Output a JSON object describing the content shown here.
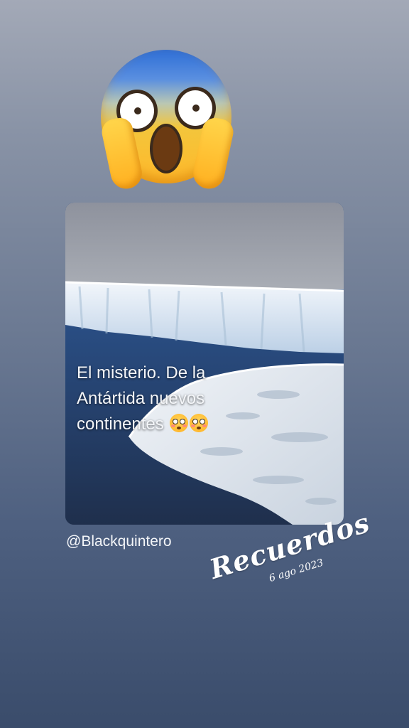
{
  "story": {
    "sticker_icon": "face-screaming-in-fear-icon",
    "post": {
      "caption_lines": [
        "El misterio. De la",
        "Antártida nuevos",
        "continentes"
      ],
      "caption_emoji": [
        "flushed-face-icon",
        "flushed-face-icon"
      ],
      "author": "@Blackquintero"
    },
    "memories": {
      "title": "Recuerdos",
      "date": "6 ago 2023"
    }
  },
  "colors": {
    "background_top": "#a3a9b7",
    "background_bottom": "#3a4c6b",
    "sky": "#9a9fa9",
    "ice": "#e6eef6",
    "water": "#253a5c"
  }
}
